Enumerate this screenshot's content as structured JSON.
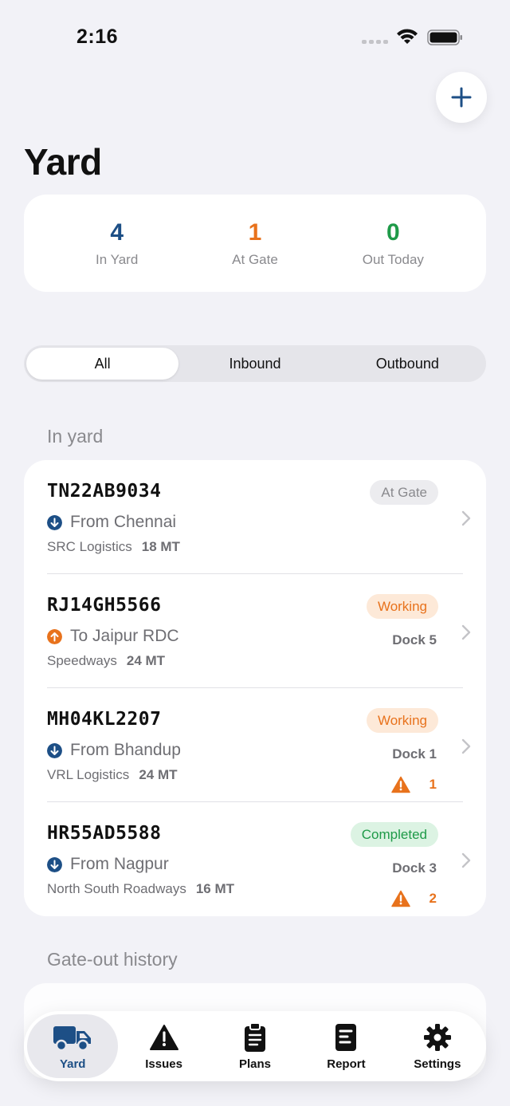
{
  "status_bar": {
    "time": "2:16"
  },
  "header": {
    "title": "Yard"
  },
  "colors": {
    "navy": "#1d4f86",
    "orange": "#e8721c",
    "green": "#1e9a48",
    "gray_text": "#8a8a8e"
  },
  "stats": [
    {
      "value": "4",
      "label": "In Yard",
      "color": "#1d4f86"
    },
    {
      "value": "1",
      "label": "At Gate",
      "color": "#e8721c"
    },
    {
      "value": "0",
      "label": "Out Today",
      "color": "#1e9a48"
    }
  ],
  "segments": {
    "all": "All",
    "inbound": "Inbound",
    "outbound": "Outbound",
    "selected": "All"
  },
  "sections": {
    "in_yard": "In yard",
    "history": "Gate-out history"
  },
  "vehicles": [
    {
      "plate": "TN22AB9034",
      "direction": "inbound",
      "route": "From Chennai",
      "carrier": "SRC Logistics",
      "weight": "18 MT",
      "status": "At Gate",
      "dock": "",
      "issues": ""
    },
    {
      "plate": "RJ14GH5566",
      "direction": "outbound",
      "route": "To Jaipur RDC",
      "carrier": "Speedways",
      "weight": "24 MT",
      "status": "Working",
      "dock": "Dock 5",
      "issues": ""
    },
    {
      "plate": "MH04KL2207",
      "direction": "inbound",
      "route": "From Bhandup",
      "carrier": "VRL Logistics",
      "weight": "24 MT",
      "status": "Working",
      "dock": "Dock 1",
      "issues": "1"
    },
    {
      "plate": "HR55AD5588",
      "direction": "inbound",
      "route": "From Nagpur",
      "carrier": "North South Roadways",
      "weight": "16 MT",
      "status": "Completed",
      "dock": "Dock 3",
      "issues": "2"
    }
  ],
  "tabs": [
    {
      "label": "Yard",
      "icon": "truck-icon",
      "active": true
    },
    {
      "label": "Issues",
      "icon": "warning-icon",
      "active": false
    },
    {
      "label": "Plans",
      "icon": "clipboard-icon",
      "active": false
    },
    {
      "label": "Report",
      "icon": "report-icon",
      "active": false
    },
    {
      "label": "Settings",
      "icon": "gear-icon",
      "active": false
    }
  ]
}
